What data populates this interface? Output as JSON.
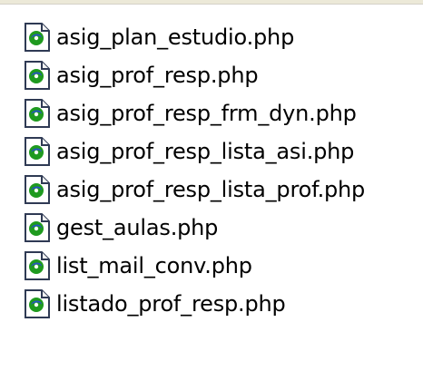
{
  "file_list": {
    "icon": "php-file-icon",
    "colors": {
      "icon_outline": "#2f3a54",
      "icon_badge_green": "#1f9a1f",
      "icon_badge_blue": "#2750c9"
    },
    "items": [
      {
        "name": "asig_plan_estudio.php"
      },
      {
        "name": "asig_prof_resp.php"
      },
      {
        "name": "asig_prof_resp_frm_dyn.php"
      },
      {
        "name": "asig_prof_resp_lista_asi.php"
      },
      {
        "name": "asig_prof_resp_lista_prof.php"
      },
      {
        "name": "gest_aulas.php"
      },
      {
        "name": "list_mail_conv.php"
      },
      {
        "name": "listado_prof_resp.php"
      }
    ]
  }
}
